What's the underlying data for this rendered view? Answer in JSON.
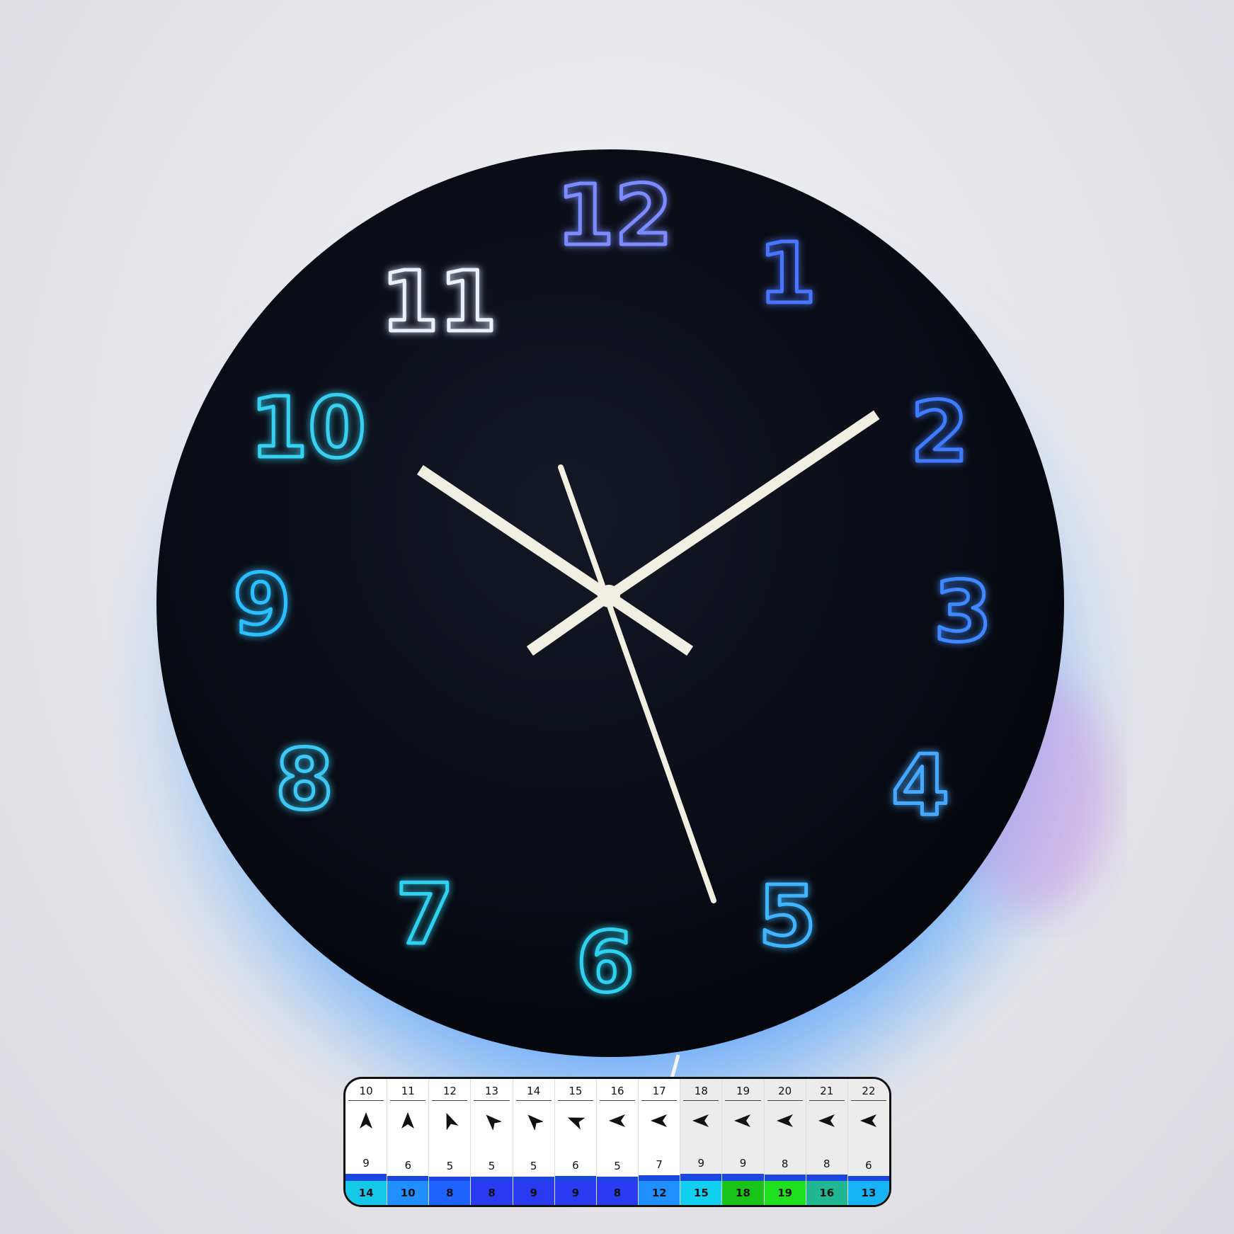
{
  "clock": {
    "numerals": [
      "12",
      "1",
      "2",
      "3",
      "4",
      "5",
      "6",
      "7",
      "8",
      "9",
      "10",
      "11"
    ],
    "glow_color": "#1e90ff",
    "hand_color": "#f1efe2",
    "face_color": "#0a0c16"
  },
  "wind_widget": {
    "hours": [
      "10",
      "11",
      "12",
      "13",
      "14",
      "15",
      "16",
      "17",
      "18",
      "19",
      "20",
      "21",
      "22"
    ],
    "arrow_directions": [
      "north",
      "north",
      "north-northwest",
      "northwest",
      "northwest",
      "west-northwest",
      "west",
      "west",
      "west",
      "west",
      "west",
      "west",
      "west"
    ],
    "wind_speeds": [
      9,
      6,
      5,
      5,
      5,
      6,
      5,
      7,
      9,
      9,
      8,
      8,
      6
    ],
    "gusts": [
      14,
      10,
      8,
      8,
      9,
      9,
      8,
      12,
      15,
      18,
      19,
      16,
      13
    ],
    "gust_colors": [
      "#16c8e8",
      "#1f8fff",
      "#1f63ff",
      "#2a3af0",
      "#2a3af0",
      "#2a3af0",
      "#2a3af0",
      "#1f8fff",
      "#12d0f0",
      "#19c419",
      "#1fe01f",
      "#1fb892",
      "#16b4f4"
    ],
    "bar_color": "#1a47e0"
  }
}
